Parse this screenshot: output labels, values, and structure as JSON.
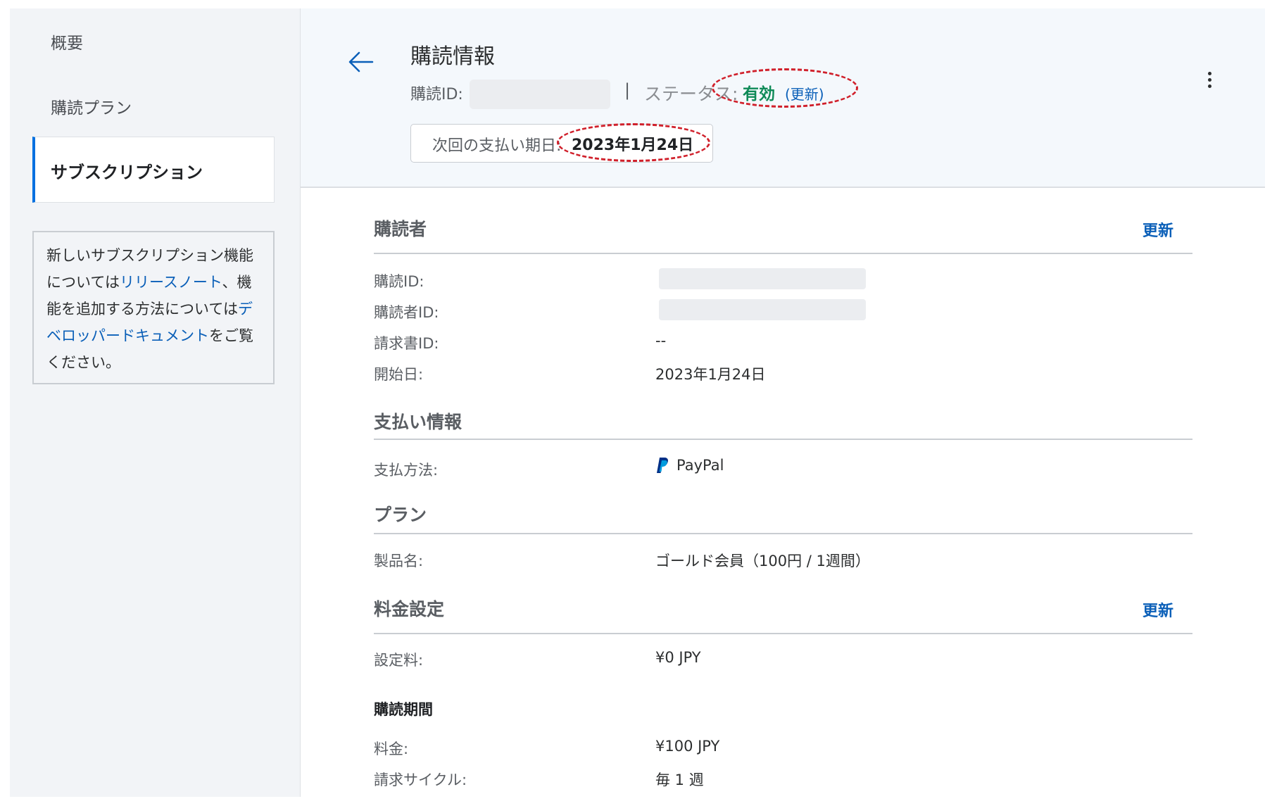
{
  "sidebar": {
    "items": [
      {
        "label": "概要"
      },
      {
        "label": "購読プラン"
      },
      {
        "label": "サブスクリプション"
      }
    ],
    "info": {
      "t1": "新しいサブスクリプション機能については",
      "link1": "リリースノート",
      "t2": "、機能を追加する方法については",
      "link2": "デベロッパードキュメント",
      "t3": "をご覧ください。"
    }
  },
  "header": {
    "title": "購読情報",
    "id_label": "購読ID:",
    "separator": "|",
    "status_label": "ステータス:",
    "status_value": "有効",
    "status_update": "(更新)",
    "next_payment_label": "次回の支払い期日:",
    "next_payment_date": "2023年1月24日"
  },
  "sections": {
    "subscriber": {
      "title": "購読者",
      "action": "更新",
      "rows": [
        {
          "label": "購読ID:",
          "value": ""
        },
        {
          "label": "購読者ID:",
          "value": ""
        },
        {
          "label": "請求書ID:",
          "value": "--"
        },
        {
          "label": "開始日:",
          "value": "2023年1月24日"
        }
      ]
    },
    "payment": {
      "title": "支払い情報",
      "rows": [
        {
          "label": "支払方法:",
          "value": "PayPal"
        }
      ]
    },
    "plan": {
      "title": "プラン",
      "rows": [
        {
          "label": "製品名:",
          "value": "ゴールド会員（100円 / 1週間）"
        }
      ]
    },
    "pricing": {
      "title": "料金設定",
      "action": "更新",
      "rows": [
        {
          "label": "設定料:",
          "value": "¥0 JPY"
        }
      ],
      "period_title": "購読期間",
      "period_rows": [
        {
          "label": "料金:",
          "value": "¥100 JPY"
        },
        {
          "label": "請求サイクル:",
          "value": "毎 1 週"
        }
      ]
    }
  },
  "colors": {
    "accent": "#0070e0",
    "link": "#0a5fb8",
    "status_active": "#0e8a57",
    "annotation": "#d0202b"
  },
  "icons": [
    "back-arrow-icon",
    "more-vertical-icon",
    "paypal-icon"
  ]
}
